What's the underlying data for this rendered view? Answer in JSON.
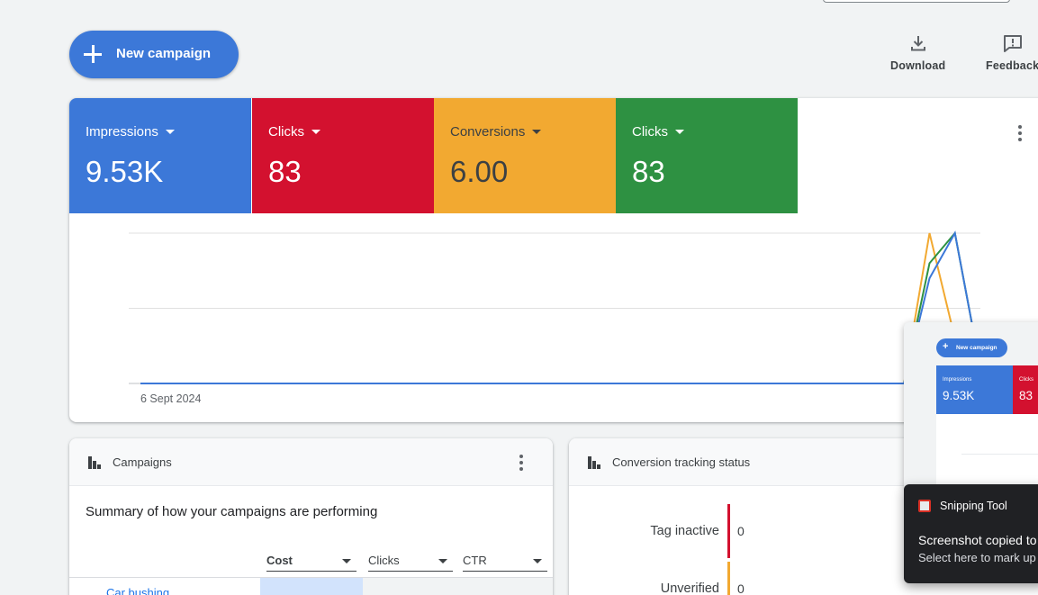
{
  "toolbar": {
    "new_campaign_label": "New campaign",
    "download_label": "Download",
    "feedback_label": "Feedback"
  },
  "overview": {
    "metrics": [
      {
        "label": "Impressions",
        "value": "9.53K",
        "color": "#3c78d8"
      },
      {
        "label": "Clicks",
        "value": "83",
        "color": "#d3112f"
      },
      {
        "label": "Conversions",
        "value": "6.00",
        "color": "#f2a931"
      },
      {
        "label": "Clicks",
        "value": "83",
        "color": "#2e9142"
      }
    ],
    "x_start_label": "6 Sept 2024"
  },
  "chart_data": {
    "type": "line",
    "xlabel": "",
    "ylabel": "",
    "x_start": "6 Sept 2024",
    "series": [
      {
        "color": "#f2a931",
        "values": [
          0,
          0,
          0,
          0,
          0,
          0,
          0,
          0,
          0,
          0,
          0,
          0,
          0,
          0,
          0,
          0,
          0,
          0,
          0,
          0,
          0,
          0,
          0,
          0,
          0,
          0,
          0,
          0,
          0,
          0,
          0,
          1.0,
          0.3,
          0
        ]
      },
      {
        "color": "#2e9142",
        "values": [
          0,
          0,
          0,
          0,
          0,
          0,
          0,
          0,
          0,
          0,
          0,
          0,
          0,
          0,
          0,
          0,
          0,
          0,
          0,
          0,
          0,
          0,
          0,
          0,
          0,
          0,
          0,
          0,
          0,
          0,
          0,
          0.8,
          1.0,
          0.1
        ]
      },
      {
        "color": "#3c78d8",
        "values": [
          0,
          0,
          0,
          0,
          0,
          0,
          0,
          0,
          0,
          0,
          0,
          0,
          0,
          0,
          0,
          0,
          0,
          0,
          0,
          0,
          0,
          0,
          0,
          0,
          0,
          0,
          0,
          0,
          0,
          0,
          0,
          0.7,
          1.0,
          0.1
        ]
      }
    ],
    "grid": true
  },
  "campaigns": {
    "title": "Campaigns",
    "summary": "Summary of how your campaigns are performing",
    "columns": [
      "Cost",
      "Clicks",
      "CTR"
    ],
    "rows": [
      {
        "name": "Car bushing"
      }
    ]
  },
  "conversion_tracking": {
    "title": "Conversion tracking status",
    "rows": [
      {
        "label": "Tag inactive",
        "value": "0",
        "color": "#d3112f"
      },
      {
        "label": "Unverified",
        "value": "0",
        "color": "#f2a931"
      }
    ]
  },
  "snipping": {
    "app": "Snipping Tool",
    "line1": "Screenshot copied to",
    "line2": "Select here to mark up",
    "preview_button": "New campaign",
    "preview_metric1_label": "Impressions",
    "preview_metric1_value": "9.53K",
    "preview_metric2_label": "Clicks",
    "preview_metric2_value": "83"
  }
}
